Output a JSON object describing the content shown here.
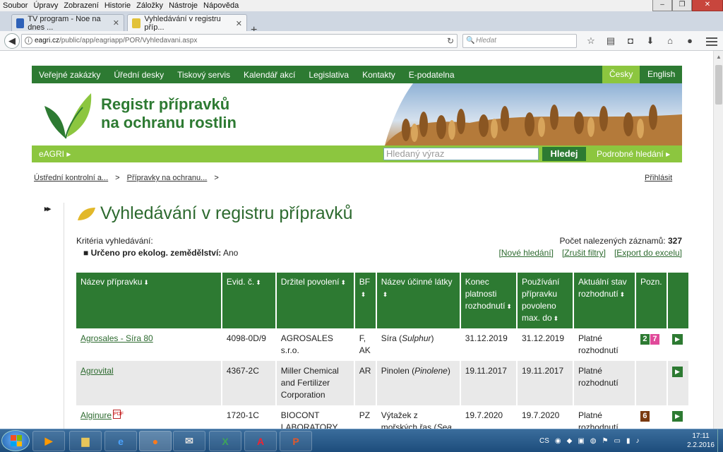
{
  "menubar": [
    "Soubor",
    "Úpravy",
    "Zobrazení",
    "Historie",
    "Záložky",
    "Nástroje",
    "Nápověda"
  ],
  "window_controls": [
    "–",
    "❐",
    "✕"
  ],
  "tabs": [
    {
      "label": "TV program - Noe na dnes ...",
      "close": "✕"
    },
    {
      "label": "Vyhledávání v registru příp...",
      "close": "✕"
    }
  ],
  "new_tab": "+",
  "url": {
    "host": "eagri.cz",
    "path": "/public/app/eagriapp/POR/Vyhledavani.aspx"
  },
  "search_placeholder": "Hledat",
  "topnav": [
    "Veřejné zakázky",
    "Úřední desky",
    "Tiskový servis",
    "Kalendář akcí",
    "Legislativa",
    "Kontakty",
    "E-podatelna"
  ],
  "languages": {
    "cz": "Česky",
    "en": "English"
  },
  "banner": {
    "line1": "Registr přípravků",
    "line2": "na ochranu rostlin"
  },
  "subnav": {
    "eagri": "eAGRI ▸",
    "search_placeholder": "Hledaný výraz",
    "search_button": "Hledej",
    "advanced": "Podrobné hledání ▸"
  },
  "breadcrumbs": [
    "Ústřední kontrolní a...",
    "Přípravky na ochranu..."
  ],
  "breadcrumb_sep": ">",
  "login": "Přihlásit",
  "toggle": "▸▸",
  "page_title": "Vyhledávání v registru přípravků",
  "criteria_label": "Kritéria vyhledávání:",
  "criteria_item": {
    "key": "Určeno pro ekolog. zemědělství:",
    "value": "Ano"
  },
  "count": {
    "label": "Počet nalezených záznamů:",
    "value": "327"
  },
  "actions": [
    "[Nové hledání]",
    "[Zrušit filtry]",
    "[Export do excelu]"
  ],
  "table": {
    "headers": [
      "Název přípravku",
      "Evid. č.",
      "Držitel povolení",
      "BF",
      "Název účinné látky",
      "Konec platnosti rozhodnutí",
      "Používání přípravku povoleno max. do",
      "Aktuální stav rozhodnutí",
      "Pozn.",
      ""
    ],
    "sort_arrows": {
      "name": "⬇",
      "other": "⬍"
    },
    "rows": [
      {
        "name": "Agrosales - Síra 80",
        "evid": "4098-0D/9",
        "holder": "AGROSALES s.r.o.",
        "bf": "F, AK",
        "substance": "Síra",
        "substance_latin": "Sulphur",
        "end": "31.12.2019",
        "max": "31.12.2019",
        "status": "Platné rozhodnutí",
        "badges": [
          {
            "t": "2",
            "c": "green"
          },
          {
            "t": "7",
            "c": "pink"
          }
        ],
        "pdf": false
      },
      {
        "name": "Agrovital",
        "evid": "4367-2C",
        "holder": "Miller Chemical and Fertilizer Corporation",
        "bf": "AR",
        "substance": "Pinolen",
        "substance_latin": "Pinolene",
        "end": "19.11.2017",
        "max": "19.11.2017",
        "status": "Platné rozhodnutí",
        "badges": [],
        "pdf": false
      },
      {
        "name": "Alginure",
        "evid": "1720-1C",
        "holder": "BIOCONT LABORATORY,",
        "bf": "PZ",
        "substance": "Výtažek z mořských řas",
        "substance_latin": "Sea",
        "end": "19.7.2020",
        "max": "19.7.2020",
        "status": "Platné rozhodnutí",
        "badges": [
          {
            "t": "6",
            "c": "brown"
          }
        ],
        "pdf": true
      }
    ],
    "row_action": "▶"
  },
  "taskbar": {
    "apps": [
      "VLC",
      "IE",
      "Firefox",
      "Mail",
      "Excel",
      "Acrobat",
      "PowerPoint"
    ],
    "lang": "CS",
    "time": "17:11",
    "date": "2.2.2016"
  },
  "colors": {
    "green": "#2d7a32",
    "lightgreen": "#8cc63f",
    "pink": "#e04a9a",
    "brown": "#7a3a10"
  }
}
